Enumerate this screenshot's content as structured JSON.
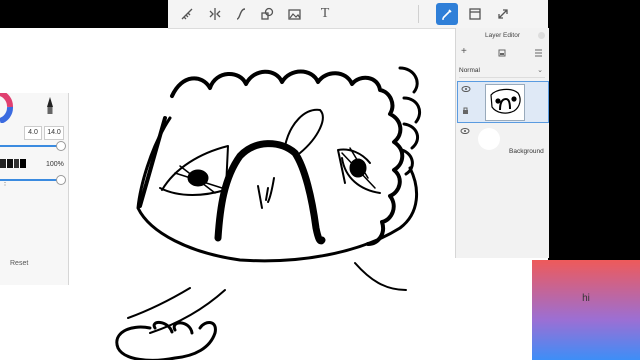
{
  "toolbar": {
    "tools": [
      "ruler-icon",
      "symmetry-icon",
      "curve-icon",
      "shapes-icon",
      "import-image-icon",
      "text-icon",
      "brush-icon",
      "frame-icon",
      "fullscreen-icon"
    ],
    "active_tool": "brush-icon",
    "text_glyph": "T"
  },
  "brush_panel": {
    "size_min": "4.0",
    "size_max": "14.0",
    "opacity": "100%",
    "reset_label": "Reset",
    "accent_color": "#3b8be0"
  },
  "layer_editor": {
    "title": "Layer Editor",
    "add_label": "+",
    "blend_mode": "Normal",
    "layers": [
      {
        "name": "",
        "selected": true
      },
      {
        "name": "Background",
        "selected": false
      }
    ]
  },
  "overlay": {
    "text": "hi",
    "colors": [
      "#ee5a5a",
      "#9b6fd4",
      "#3d8ef7"
    ]
  }
}
